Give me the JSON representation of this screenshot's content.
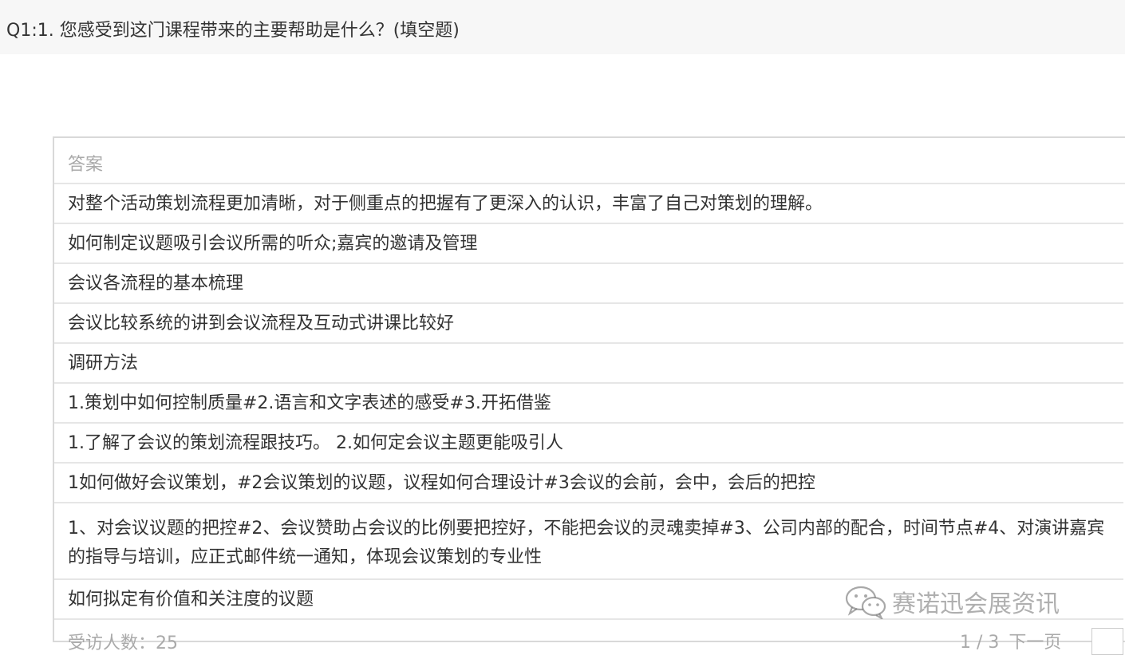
{
  "question": {
    "title": "Q1:1. 您感受到这门课程带来的主要帮助是什么？(填空题)"
  },
  "table": {
    "header": "答案",
    "rows": [
      "对整个活动策划流程更加清晰，对于侧重点的把握有了更深入的认识，丰富了自己对策划的理解。",
      "如何制定议题吸引会议所需的听众;嘉宾的邀请及管理",
      "会议各流程的基本梳理",
      "会议比较系统的讲到会议流程及互动式讲课比较好",
      "调研方法",
      "1.策划中如何控制质量#2.语言和文字表述的感受#3.开拓借鉴",
      "1.了解了会议的策划流程跟技巧。 2.如何定会议主题更能吸引人",
      "1如何做好会议策划，#2会议策划的议题，议程如何合理设计#3会议的会前，会中，会后的把控",
      "1、对会议议题的把控#2、会议赞助占会议的比例要把控好，不能把会议的灵魂卖掉#3、公司内部的配合，时间节点#4、对演讲嘉宾的指导与培训，应正式邮件统一通知，体现会议策划的专业性",
      "如何拟定有价值和关注度的议题"
    ]
  },
  "footer": {
    "respondents_label": "受访人数：",
    "respondents_count": "25",
    "page_indicator": "1 / 3",
    "next_label": "下一页"
  },
  "watermark": {
    "text": "赛诺迅会展资讯",
    "icon": "wechat-icon"
  },
  "colors": {
    "header_bg": "#f7f7f7",
    "border": "#d9d9d9",
    "muted_text": "#aaaaaa",
    "body_text": "#333333"
  }
}
